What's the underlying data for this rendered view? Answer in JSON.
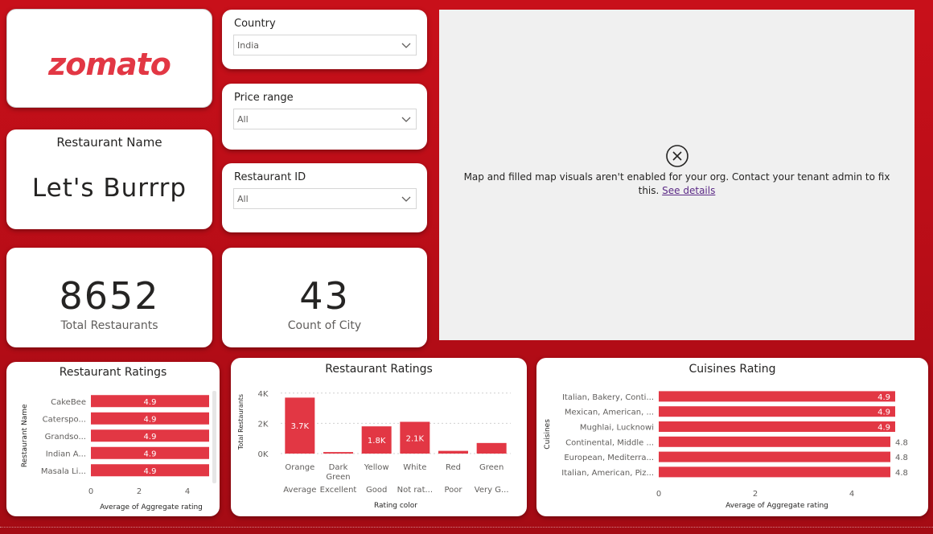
{
  "logo": {
    "text": "zomato"
  },
  "restaurant_name": {
    "label": "Restaurant Name",
    "value": "Let's Burrrp"
  },
  "kpis": {
    "total_restaurants": {
      "value": "8652",
      "label": "Total Restaurants"
    },
    "count_of_city": {
      "value": "43",
      "label": "Count of City"
    }
  },
  "slicers": {
    "country": {
      "title": "Country",
      "value": "India"
    },
    "price_range": {
      "title": "Price range",
      "value": "All"
    },
    "restaurant_id": {
      "title": "Restaurant ID",
      "value": "All"
    }
  },
  "map": {
    "error_text": "Map and filled map visuals aren't enabled for your org. Contact your tenant admin to fix this.",
    "link_text": "See details"
  },
  "colors": {
    "bar": "#e23744",
    "accent": "#c8101a"
  },
  "chart_data": [
    {
      "type": "bar",
      "orientation": "horizontal",
      "title": "Restaurant Ratings",
      "xlabel": "Average of Aggregate rating",
      "ylabel": "Restaurant Name",
      "categories": [
        "CakeBee",
        "Caterspo...",
        "Grandso...",
        "Indian A...",
        "Masala Li..."
      ],
      "values": [
        4.9,
        4.9,
        4.9,
        4.9,
        4.9
      ],
      "data_labels": [
        "4.9",
        "4.9",
        "4.9",
        "4.9",
        "4.9"
      ],
      "xlim": [
        0,
        5
      ],
      "x_ticks": [
        "0",
        "2",
        "4"
      ]
    },
    {
      "type": "bar",
      "orientation": "vertical",
      "title": "Restaurant Ratings",
      "xlabel": "Rating color",
      "ylabel": "Total Restaurants",
      "categories": [
        "Orange",
        "Dark Green",
        "Yellow",
        "White",
        "Red",
        "Green"
      ],
      "sub_categories": [
        "Average",
        "Excellent",
        "Good",
        "Not rat...",
        "Poor",
        "Very G..."
      ],
      "values": [
        3700,
        100,
        1800,
        2100,
        180,
        700
      ],
      "data_labels": [
        "3.7K",
        "",
        "1.8K",
        "2.1K",
        "",
        ""
      ],
      "ylim": [
        0,
        4200
      ],
      "y_ticks": [
        "0K",
        "2K",
        "4K"
      ]
    },
    {
      "type": "bar",
      "orientation": "horizontal",
      "title": "Cuisines Rating",
      "xlabel": "Average of Aggregate rating",
      "ylabel": "Cuisines",
      "categories": [
        "Italian, Bakery, Conti...",
        "Mexican, American, ...",
        "Mughlai, Lucknowi",
        "Continental, Middle ...",
        "European, Mediterra...",
        "Italian, American, Piz..."
      ],
      "values": [
        4.9,
        4.9,
        4.9,
        4.8,
        4.8,
        4.8
      ],
      "data_labels": [
        "4.9",
        "4.9",
        "4.9",
        "4.8",
        "4.8",
        "4.8"
      ],
      "xlim": [
        0,
        4.9
      ],
      "x_ticks": [
        "0",
        "2",
        "4"
      ]
    }
  ]
}
